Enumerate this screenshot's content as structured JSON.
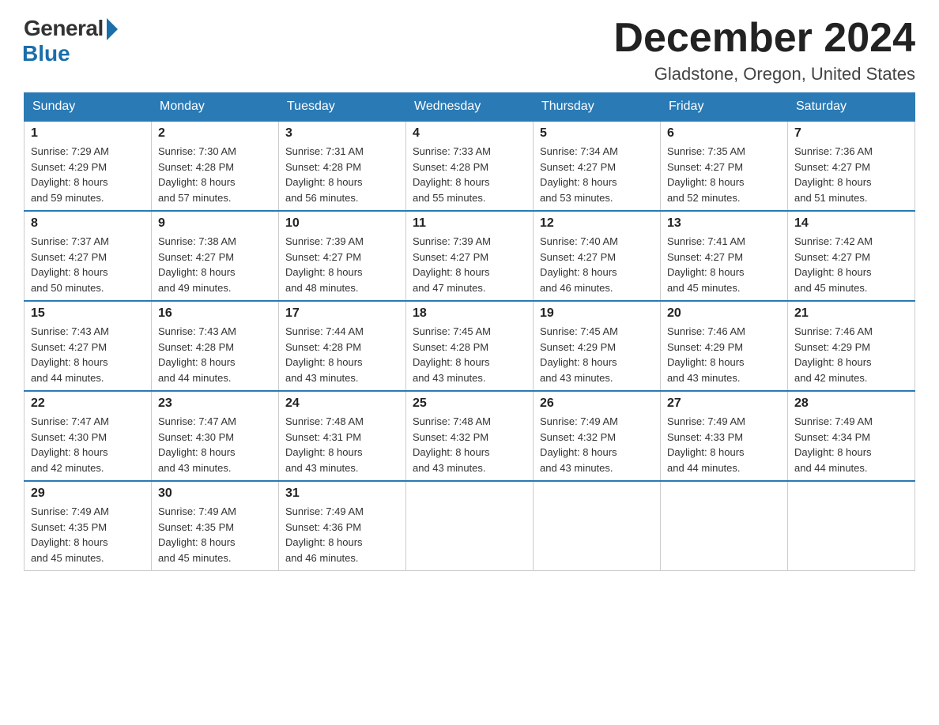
{
  "header": {
    "logo_general": "General",
    "logo_blue": "Blue",
    "month_title": "December 2024",
    "location": "Gladstone, Oregon, United States"
  },
  "weekdays": [
    "Sunday",
    "Monday",
    "Tuesday",
    "Wednesday",
    "Thursday",
    "Friday",
    "Saturday"
  ],
  "weeks": [
    [
      {
        "day": "1",
        "sunrise": "7:29 AM",
        "sunset": "4:29 PM",
        "daylight": "8 hours and 59 minutes."
      },
      {
        "day": "2",
        "sunrise": "7:30 AM",
        "sunset": "4:28 PM",
        "daylight": "8 hours and 57 minutes."
      },
      {
        "day": "3",
        "sunrise": "7:31 AM",
        "sunset": "4:28 PM",
        "daylight": "8 hours and 56 minutes."
      },
      {
        "day": "4",
        "sunrise": "7:33 AM",
        "sunset": "4:28 PM",
        "daylight": "8 hours and 55 minutes."
      },
      {
        "day": "5",
        "sunrise": "7:34 AM",
        "sunset": "4:27 PM",
        "daylight": "8 hours and 53 minutes."
      },
      {
        "day": "6",
        "sunrise": "7:35 AM",
        "sunset": "4:27 PM",
        "daylight": "8 hours and 52 minutes."
      },
      {
        "day": "7",
        "sunrise": "7:36 AM",
        "sunset": "4:27 PM",
        "daylight": "8 hours and 51 minutes."
      }
    ],
    [
      {
        "day": "8",
        "sunrise": "7:37 AM",
        "sunset": "4:27 PM",
        "daylight": "8 hours and 50 minutes."
      },
      {
        "day": "9",
        "sunrise": "7:38 AM",
        "sunset": "4:27 PM",
        "daylight": "8 hours and 49 minutes."
      },
      {
        "day": "10",
        "sunrise": "7:39 AM",
        "sunset": "4:27 PM",
        "daylight": "8 hours and 48 minutes."
      },
      {
        "day": "11",
        "sunrise": "7:39 AM",
        "sunset": "4:27 PM",
        "daylight": "8 hours and 47 minutes."
      },
      {
        "day": "12",
        "sunrise": "7:40 AM",
        "sunset": "4:27 PM",
        "daylight": "8 hours and 46 minutes."
      },
      {
        "day": "13",
        "sunrise": "7:41 AM",
        "sunset": "4:27 PM",
        "daylight": "8 hours and 45 minutes."
      },
      {
        "day": "14",
        "sunrise": "7:42 AM",
        "sunset": "4:27 PM",
        "daylight": "8 hours and 45 minutes."
      }
    ],
    [
      {
        "day": "15",
        "sunrise": "7:43 AM",
        "sunset": "4:27 PM",
        "daylight": "8 hours and 44 minutes."
      },
      {
        "day": "16",
        "sunrise": "7:43 AM",
        "sunset": "4:28 PM",
        "daylight": "8 hours and 44 minutes."
      },
      {
        "day": "17",
        "sunrise": "7:44 AM",
        "sunset": "4:28 PM",
        "daylight": "8 hours and 43 minutes."
      },
      {
        "day": "18",
        "sunrise": "7:45 AM",
        "sunset": "4:28 PM",
        "daylight": "8 hours and 43 minutes."
      },
      {
        "day": "19",
        "sunrise": "7:45 AM",
        "sunset": "4:29 PM",
        "daylight": "8 hours and 43 minutes."
      },
      {
        "day": "20",
        "sunrise": "7:46 AM",
        "sunset": "4:29 PM",
        "daylight": "8 hours and 43 minutes."
      },
      {
        "day": "21",
        "sunrise": "7:46 AM",
        "sunset": "4:29 PM",
        "daylight": "8 hours and 42 minutes."
      }
    ],
    [
      {
        "day": "22",
        "sunrise": "7:47 AM",
        "sunset": "4:30 PM",
        "daylight": "8 hours and 42 minutes."
      },
      {
        "day": "23",
        "sunrise": "7:47 AM",
        "sunset": "4:30 PM",
        "daylight": "8 hours and 43 minutes."
      },
      {
        "day": "24",
        "sunrise": "7:48 AM",
        "sunset": "4:31 PM",
        "daylight": "8 hours and 43 minutes."
      },
      {
        "day": "25",
        "sunrise": "7:48 AM",
        "sunset": "4:32 PM",
        "daylight": "8 hours and 43 minutes."
      },
      {
        "day": "26",
        "sunrise": "7:49 AM",
        "sunset": "4:32 PM",
        "daylight": "8 hours and 43 minutes."
      },
      {
        "day": "27",
        "sunrise": "7:49 AM",
        "sunset": "4:33 PM",
        "daylight": "8 hours and 44 minutes."
      },
      {
        "day": "28",
        "sunrise": "7:49 AM",
        "sunset": "4:34 PM",
        "daylight": "8 hours and 44 minutes."
      }
    ],
    [
      {
        "day": "29",
        "sunrise": "7:49 AM",
        "sunset": "4:35 PM",
        "daylight": "8 hours and 45 minutes."
      },
      {
        "day": "30",
        "sunrise": "7:49 AM",
        "sunset": "4:35 PM",
        "daylight": "8 hours and 45 minutes."
      },
      {
        "day": "31",
        "sunrise": "7:49 AM",
        "sunset": "4:36 PM",
        "daylight": "8 hours and 46 minutes."
      },
      null,
      null,
      null,
      null
    ]
  ],
  "labels": {
    "sunrise": "Sunrise:",
    "sunset": "Sunset:",
    "daylight": "Daylight:"
  }
}
